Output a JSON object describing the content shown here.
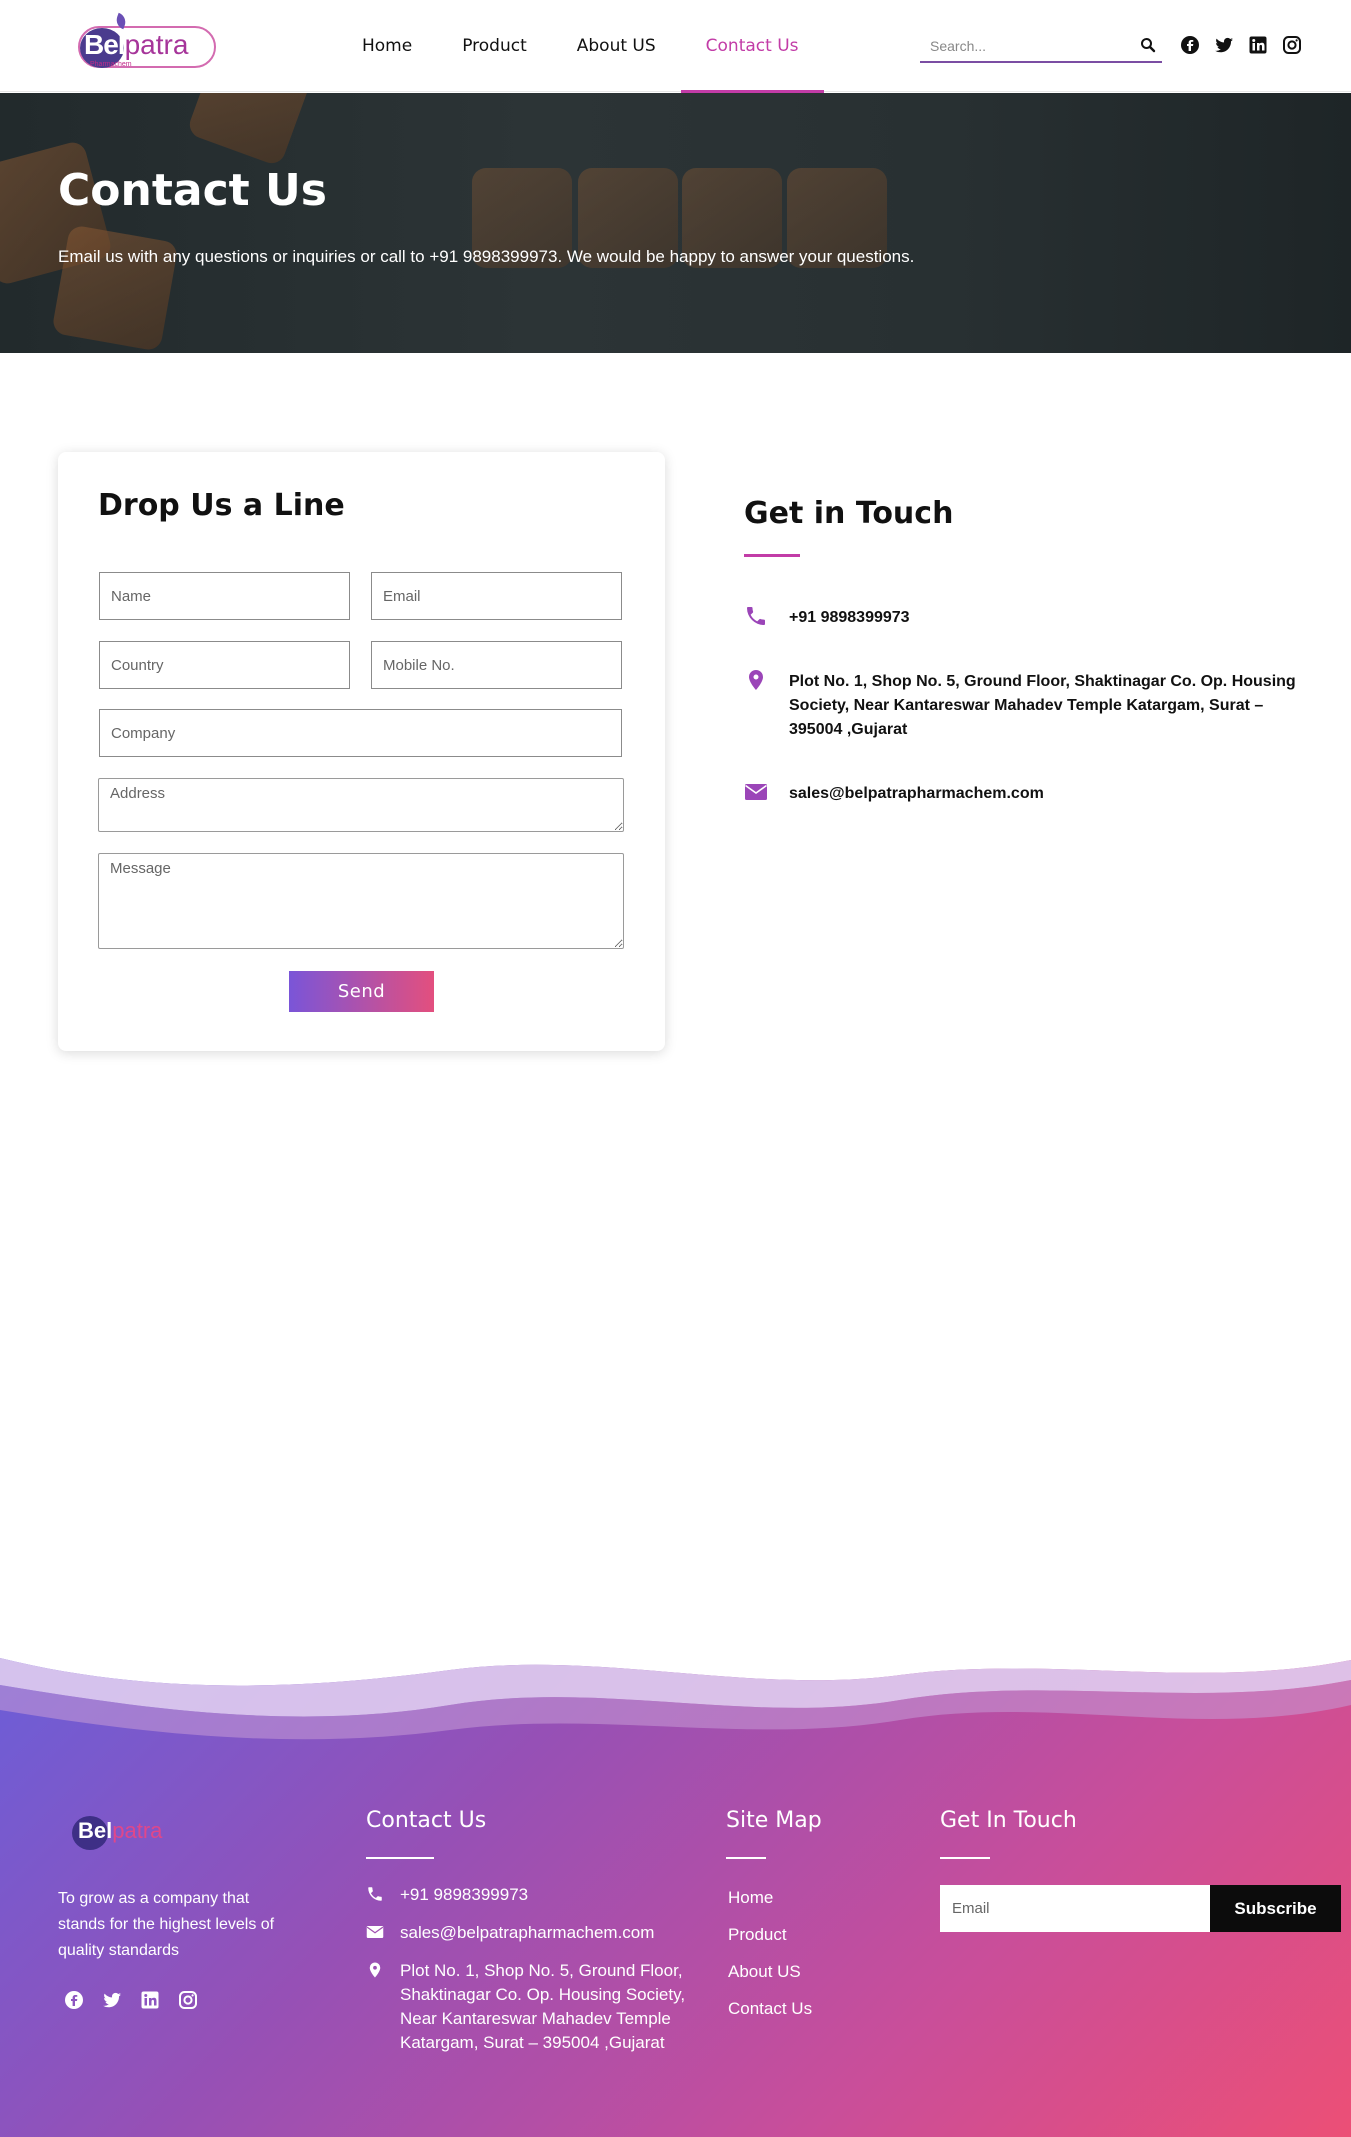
{
  "brand": {
    "name_part1": "Bel",
    "name_part2": "patra",
    "tagline": "Pharmachem",
    "accent_color": "#c23ca7"
  },
  "nav": {
    "items": [
      {
        "label": "Home",
        "active": false
      },
      {
        "label": "Product",
        "active": false
      },
      {
        "label": "About US",
        "active": false
      },
      {
        "label": "Contact Us",
        "active": true
      }
    ]
  },
  "search": {
    "placeholder": "Search...",
    "icon": "search-icon"
  },
  "social_icons": [
    "facebook-icon",
    "twitter-icon",
    "linkedin-icon",
    "instagram-icon"
  ],
  "hero": {
    "title": "Contact Us",
    "text": "Email us with any questions or inquiries or call to +91 9898399973. We would be happy to answer your questions."
  },
  "form": {
    "title": "Drop Us a Line",
    "name_placeholder": "Name",
    "email_placeholder": "Email",
    "country_placeholder": "Country",
    "mobile_placeholder": "Mobile No.",
    "company_placeholder": "Company",
    "address_placeholder": "Address",
    "message_placeholder": "Message",
    "send_label": "Send"
  },
  "get_in_touch": {
    "title": "Get in Touch",
    "phone": "+91 9898399973",
    "address": "Plot No. 1, Shop No. 5, Ground Floor, Shaktinagar Co. Op. Housing Society, Near Kantareswar Mahadev Temple Katargam, Surat – 395004 ,Gujarat",
    "email": "sales@belpatrapharmachem.com"
  },
  "footer": {
    "logo_part1": "Bel",
    "logo_part2": "patra",
    "about": "To grow as a company that stands for the highest levels of quality standards",
    "contact_title": "Contact Us",
    "phone": "+91 9898399973",
    "email": "sales@belpatrapharmachem.com",
    "address": "Plot No. 1, Shop No. 5, Ground Floor, Shaktinagar Co. Op. Housing Society, Near Kantareswar Mahadev Temple Katargam, Surat – 395004 ,Gujarat",
    "sitemap_title": "Site Map",
    "sitemap_links": [
      "Home",
      "Product",
      "About US",
      "Contact Us"
    ],
    "touch_title": "Get In Touch",
    "subscribe_placeholder": "Email",
    "subscribe_label": "Subscribe"
  }
}
